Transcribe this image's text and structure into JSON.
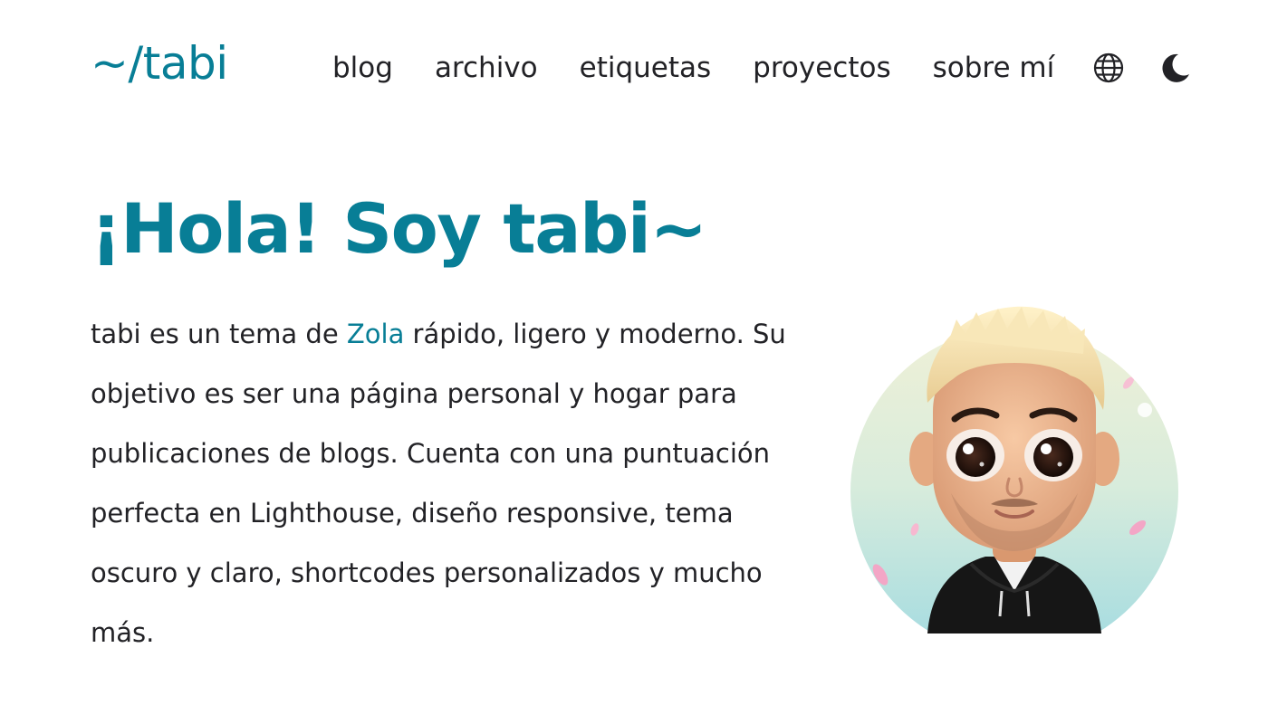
{
  "site": {
    "logo": "~/tabi"
  },
  "nav": {
    "items": [
      {
        "label": "blog"
      },
      {
        "label": "archivo"
      },
      {
        "label": "etiquetas"
      },
      {
        "label": "proyectos"
      },
      {
        "label": "sobre mí"
      }
    ],
    "language_icon": "globe-icon",
    "theme_icon": "moon-icon"
  },
  "hero": {
    "title": "¡Hola! Soy tabi~",
    "intro_before_link": "tabi es un tema de ",
    "link_text": "Zola",
    "intro_after_link": " rápido, ligero y moderno. Su objetivo es ser una página personal y hogar para publicaciones de blogs. Cuenta con una puntuación perfecta en Lighthouse, diseño responsive, tema oscuro y claro, shortcodes personalizados y mucho más.",
    "avatar_icon": "avatar-illustration"
  },
  "colors": {
    "accent": "#087e96",
    "text": "#222226",
    "background": "#ffffff"
  }
}
